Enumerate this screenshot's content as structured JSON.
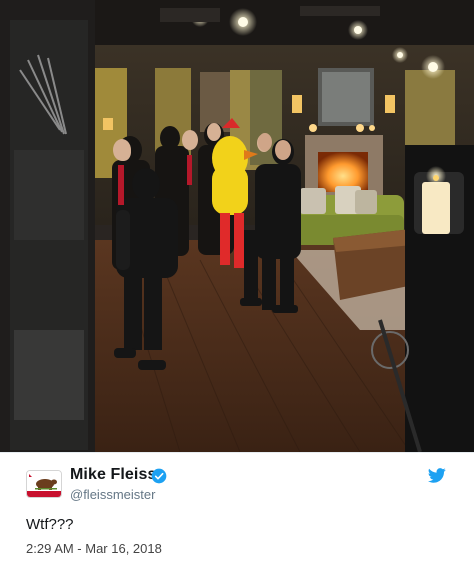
{
  "tweet": {
    "display_name": "Mike Fleiss",
    "handle": "@fleissmeister",
    "verified": true,
    "text": "Wtf???",
    "timestamp": "2:29 AM - Mar 16, 2018"
  },
  "icons": {
    "verified": "verified-badge-icon",
    "platform": "twitter-bird-icon"
  },
  "colors": {
    "verified_blue": "#1da1f2",
    "text": "#14171a",
    "muted": "#657786"
  }
}
